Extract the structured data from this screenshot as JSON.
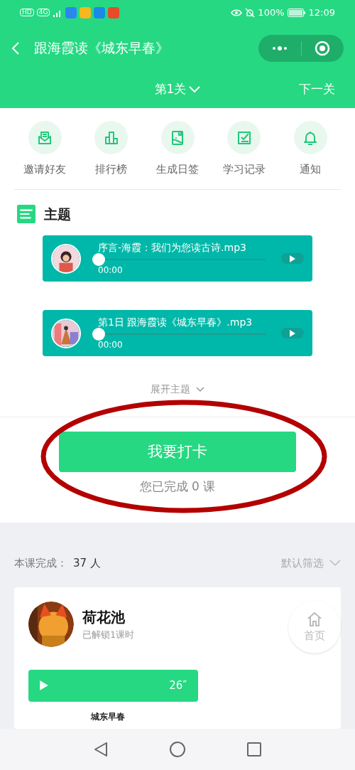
{
  "status_bar": {
    "network": [
      "HD",
      "4G"
    ],
    "battery": "100%",
    "time": "12:09"
  },
  "nav": {
    "title": "跟海霞读《城东早春》"
  },
  "level_bar": {
    "level_label": "第1关",
    "next": "下一关"
  },
  "shortcuts": [
    {
      "kind": "invite",
      "label": "邀请好友"
    },
    {
      "kind": "rank",
      "label": "排行榜"
    },
    {
      "kind": "card",
      "label": "生成日签"
    },
    {
      "kind": "record",
      "label": "学习记录"
    },
    {
      "kind": "bell",
      "label": "通知"
    }
  ],
  "topic": {
    "title": "主题",
    "expand": "展开主题"
  },
  "audios": [
    {
      "title": "序言-海霞：我们为您读古诗.mp3",
      "time": "00:00",
      "level": 0
    },
    {
      "title": "第1日 跟海霞读《城东早春》.mp3",
      "time": "00:00",
      "level": 0
    }
  ],
  "checkin": {
    "button": "我要打卡",
    "done": "您已完成 0 课"
  },
  "completion": {
    "label": "本课完成：",
    "count": "37 人",
    "filter": "默认筛选"
  },
  "post": {
    "name": "荷花池",
    "sub": "已解锁1课时",
    "duration": "26″",
    "caption": "城东早春"
  },
  "home_button": {
    "label": "首页"
  }
}
